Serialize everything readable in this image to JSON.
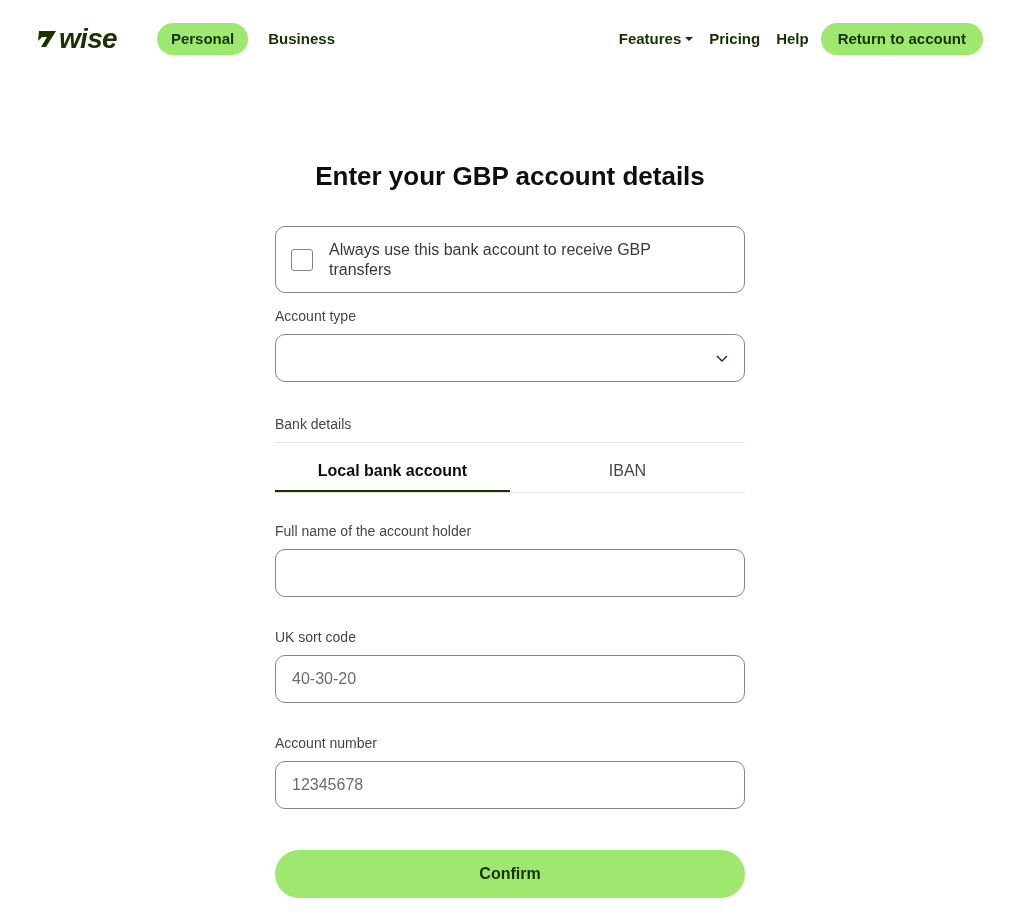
{
  "header": {
    "logo": "wise",
    "segments": [
      {
        "label": "Personal",
        "selected": true
      },
      {
        "label": "Business",
        "selected": false
      }
    ],
    "nav": [
      {
        "label": "Features",
        "kind": "dropdown"
      },
      {
        "label": "Pricing",
        "kind": "link"
      },
      {
        "label": "Help",
        "kind": "link"
      }
    ],
    "cta": "Return to account"
  },
  "title": "Enter your GBP account details",
  "checkbox": {
    "label": "Always use this bank account to receive GBP transfers",
    "checked": false
  },
  "account_type": {
    "label": "Account type"
  },
  "bank_details": {
    "label": "Bank details",
    "tabs": [
      {
        "label": "Local bank account",
        "selected": true
      },
      {
        "label": "IBAN",
        "selected": false
      }
    ]
  },
  "fields": [
    {
      "label": "Full name of the account holder"
    },
    {
      "label": "UK sort code",
      "placeholder": "40-30-20"
    },
    {
      "label": "Account number",
      "placeholder": "12345678"
    }
  ],
  "confirm": "Confirm"
}
